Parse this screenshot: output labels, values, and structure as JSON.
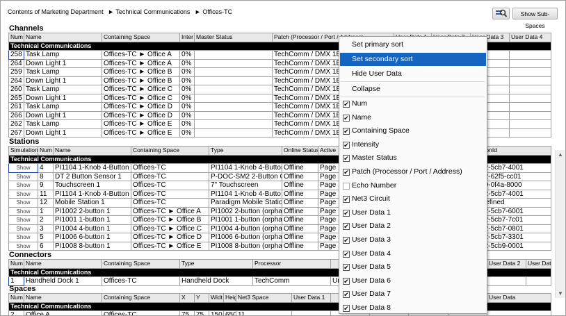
{
  "breadcrumb": [
    "Contents of Marketing Department",
    "► Technical Communications",
    "► Offices-TC"
  ],
  "toolbar": {
    "zoom_icon": "zoom-icon",
    "show_subspaces": "Show Sub-Spaces"
  },
  "channels": {
    "title": "Channels",
    "headers": [
      "Num",
      "Name",
      "Containing Space",
      "Inter",
      "Master Status",
      "Patch (Processor / Port / Address)",
      "User Data 1",
      "User Data 2",
      "User Data 3",
      "User Data 4"
    ],
    "group": "Technical Communications",
    "rows": [
      [
        "258",
        "Task Lamp",
        "Offices-TC ► Office A",
        "0%",
        "",
        "TechComm / DMX 1B",
        "",
        "",
        "",
        ""
      ],
      [
        "264",
        "Down Light 1",
        "Offices-TC ► Office A",
        "0%",
        "",
        "TechComm / DMX 1B",
        "",
        "",
        "",
        ""
      ],
      [
        "259",
        "Task Lamp",
        "Offices-TC ► Office B",
        "0%",
        "",
        "TechComm / DMX 1B",
        "",
        "",
        "",
        ""
      ],
      [
        "264",
        "Down Light 1",
        "Offices-TC ► Office B",
        "0%",
        "",
        "TechComm / DMX 1B",
        "",
        "",
        "",
        ""
      ],
      [
        "260",
        "Task Lamp",
        "Offices-TC ► Office C",
        "0%",
        "",
        "TechComm / DMX 1B",
        "",
        "",
        "",
        ""
      ],
      [
        "265",
        "Down Light 1",
        "Offices-TC ► Office C",
        "0%",
        "",
        "TechComm / DMX 1B",
        "",
        "",
        "",
        ""
      ],
      [
        "261",
        "Task Lamp",
        "Offices-TC ► Office D",
        "0%",
        "",
        "TechComm / DMX 1B",
        "",
        "",
        "",
        ""
      ],
      [
        "266",
        "Down Light 1",
        "Offices-TC ► Office D",
        "0%",
        "",
        "TechComm / DMX 1B",
        "",
        "",
        "",
        ""
      ],
      [
        "262",
        "Task Lamp",
        "Offices-TC ► Office E",
        "0%",
        "",
        "TechComm / DMX 1B",
        "",
        "",
        "",
        ""
      ],
      [
        "267",
        "Down Light 1",
        "Offices-TC ► Office E",
        "0%",
        "",
        "TechComm / DMX 1B",
        "",
        "",
        "",
        ""
      ]
    ]
  },
  "stations": {
    "title": "Stations",
    "headers": [
      "Simulation",
      "Num",
      "Name",
      "Containing Space",
      "Type",
      "Online Status",
      "Active",
      "",
      "",
      "NeuronId"
    ],
    "group": "Technical Communications",
    "rows": [
      [
        "Show",
        "4",
        "PI1104 1-Knob 4-Button",
        "Offices-TC",
        "PI1104 1-Knob 4-Button",
        "Offline",
        "Page 1",
        "",
        "",
        "0702-5cb7-4001"
      ],
      [
        "Show",
        "8",
        "DT 2 Button Sensor 1",
        "Offices-TC",
        "P-DOC-SM2 2-Button O",
        "Offline",
        "Page 1",
        "",
        "",
        "0702-62f5-cc01"
      ],
      [
        "Show",
        "9",
        "Touchscreen 1",
        "Offices-TC",
        "7\" Touchscreen",
        "Offline",
        "Page 1",
        "",
        "",
        "0700-0f4a-8000"
      ],
      [
        "Show",
        "11",
        "PI1104 1-Knob 4-Button",
        "Offices-TC",
        "PI1104 1-Knob 4-Butto",
        "Offline",
        "Page 1",
        "",
        "",
        "0702-5cb7-4001"
      ],
      [
        "Show",
        "12",
        "Mobile Station 1",
        "Offices-TC",
        "Paradigm Mobile Station",
        "Offline",
        "Page 1",
        "",
        "",
        "Undefined"
      ],
      [
        "Show",
        "1",
        "PI1002 2-button 1",
        "Offices-TC ► Office A",
        "PI1002 2-button (orpha",
        "Offline",
        "Page 1",
        "",
        "",
        "0702-5cb7-6001"
      ],
      [
        "Show",
        "2",
        "PI1001 1-button 1",
        "Offices-TC ► Office B",
        "PI1001 1-button (orpha",
        "Offline",
        "Page 1",
        "",
        "",
        "0702-5cb7-7c01"
      ],
      [
        "Show",
        "3",
        "PI1004 4-button 1",
        "Offices-TC ► Office C",
        "PI1004 4-button (orpha",
        "Offline",
        "Page 1",
        "",
        "",
        "0702-5cb7-0801"
      ],
      [
        "Show",
        "5",
        "PI1006 6-button 1",
        "Offices-TC ► Office D",
        "PI1006 6-button (orpha",
        "Offline",
        "Page 1",
        "",
        "",
        "0702-5cb7-3301"
      ],
      [
        "Show",
        "6",
        "PI1008 8-button 1",
        "Offices-TC ► Office E",
        "PI1008 8-button (orpha",
        "Offline",
        "Page 1",
        "",
        "",
        "0702-5cb9-0001"
      ]
    ]
  },
  "connectors": {
    "title": "Connectors",
    "headers": [
      "Num",
      "Name",
      "Containing Space",
      "Type",
      "Processor",
      "",
      "",
      "User Data 2",
      "User Data"
    ],
    "group": "Technical Communications",
    "rows": [
      [
        "1",
        "Handheld Dock 1",
        "Offices-TC",
        "Handheld Dock",
        "TechComm",
        "Un",
        "",
        "",
        ""
      ]
    ]
  },
  "spaces": {
    "title": "Spaces",
    "headers": [
      "Num",
      "Name",
      "Containing Space",
      "X",
      "Y",
      "Widt",
      "Heig",
      "Net3 Space",
      "User Data 1",
      "",
      "",
      "",
      "User Data 6",
      "User Data"
    ],
    "group": "Technical Communications",
    "rows": [
      [
        "2",
        "Office A",
        "Offices-TC",
        "75",
        "75",
        "150",
        "650",
        "11",
        "",
        "",
        "",
        "",
        "",
        ""
      ]
    ]
  },
  "context_menu": {
    "actions": [
      {
        "label": "Set primary sort",
        "highlighted": false
      },
      {
        "label": "Set secondary sort",
        "highlighted": true
      },
      {
        "label": "Hide User Data",
        "highlighted": false
      },
      {
        "label": "Collapse",
        "highlighted": false
      }
    ],
    "columns": [
      {
        "label": "Num",
        "checked": true
      },
      {
        "label": "Name",
        "checked": true
      },
      {
        "label": "Containing Space",
        "checked": true
      },
      {
        "label": "Intensity",
        "checked": true
      },
      {
        "label": "Master Status",
        "checked": true
      },
      {
        "label": "Patch (Processor / Port / Address)",
        "checked": true
      },
      {
        "label": "Echo Number",
        "checked": false
      },
      {
        "label": "Net3 Circuit",
        "checked": true
      },
      {
        "label": "User Data 1",
        "checked": true
      },
      {
        "label": "User Data 2",
        "checked": true
      },
      {
        "label": "User Data 3",
        "checked": true
      },
      {
        "label": "User Data 4",
        "checked": true
      },
      {
        "label": "User Data 5",
        "checked": true
      },
      {
        "label": "User Data 6",
        "checked": true
      },
      {
        "label": "User Data 7",
        "checked": true
      },
      {
        "label": "User Data 8",
        "checked": true
      }
    ]
  }
}
